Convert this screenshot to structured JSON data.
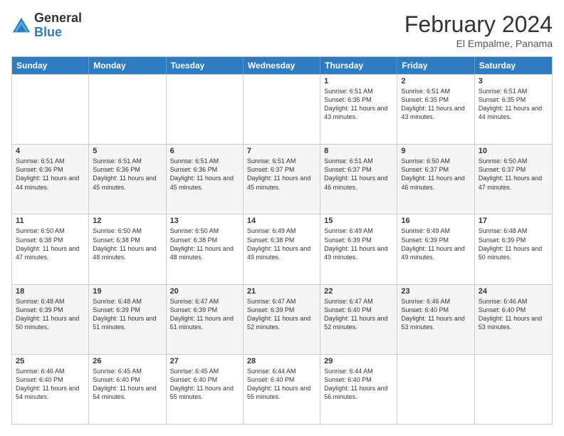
{
  "header": {
    "logo_general": "General",
    "logo_blue": "Blue",
    "month_year": "February 2024",
    "location": "El Empalme, Panama"
  },
  "days_of_week": [
    "Sunday",
    "Monday",
    "Tuesday",
    "Wednesday",
    "Thursday",
    "Friday",
    "Saturday"
  ],
  "weeks": [
    [
      {
        "day": "",
        "sunrise": "",
        "sunset": "",
        "daylight": ""
      },
      {
        "day": "",
        "sunrise": "",
        "sunset": "",
        "daylight": ""
      },
      {
        "day": "",
        "sunrise": "",
        "sunset": "",
        "daylight": ""
      },
      {
        "day": "",
        "sunrise": "",
        "sunset": "",
        "daylight": ""
      },
      {
        "day": "1",
        "sunrise": "6:51 AM",
        "sunset": "6:35 PM",
        "daylight": "11 hours and 43 minutes."
      },
      {
        "day": "2",
        "sunrise": "6:51 AM",
        "sunset": "6:35 PM",
        "daylight": "11 hours and 43 minutes."
      },
      {
        "day": "3",
        "sunrise": "6:51 AM",
        "sunset": "6:35 PM",
        "daylight": "11 hours and 44 minutes."
      }
    ],
    [
      {
        "day": "4",
        "sunrise": "6:51 AM",
        "sunset": "6:36 PM",
        "daylight": "11 hours and 44 minutes."
      },
      {
        "day": "5",
        "sunrise": "6:51 AM",
        "sunset": "6:36 PM",
        "daylight": "11 hours and 45 minutes."
      },
      {
        "day": "6",
        "sunrise": "6:51 AM",
        "sunset": "6:36 PM",
        "daylight": "11 hours and 45 minutes."
      },
      {
        "day": "7",
        "sunrise": "6:51 AM",
        "sunset": "6:37 PM",
        "daylight": "11 hours and 45 minutes."
      },
      {
        "day": "8",
        "sunrise": "6:51 AM",
        "sunset": "6:37 PM",
        "daylight": "11 hours and 46 minutes."
      },
      {
        "day": "9",
        "sunrise": "6:50 AM",
        "sunset": "6:37 PM",
        "daylight": "11 hours and 46 minutes."
      },
      {
        "day": "10",
        "sunrise": "6:50 AM",
        "sunset": "6:37 PM",
        "daylight": "11 hours and 47 minutes."
      }
    ],
    [
      {
        "day": "11",
        "sunrise": "6:50 AM",
        "sunset": "6:38 PM",
        "daylight": "11 hours and 47 minutes."
      },
      {
        "day": "12",
        "sunrise": "6:50 AM",
        "sunset": "6:38 PM",
        "daylight": "11 hours and 48 minutes."
      },
      {
        "day": "13",
        "sunrise": "6:50 AM",
        "sunset": "6:38 PM",
        "daylight": "11 hours and 48 minutes."
      },
      {
        "day": "14",
        "sunrise": "6:49 AM",
        "sunset": "6:38 PM",
        "daylight": "11 hours and 49 minutes."
      },
      {
        "day": "15",
        "sunrise": "6:49 AM",
        "sunset": "6:39 PM",
        "daylight": "11 hours and 49 minutes."
      },
      {
        "day": "16",
        "sunrise": "6:49 AM",
        "sunset": "6:39 PM",
        "daylight": "11 hours and 49 minutes."
      },
      {
        "day": "17",
        "sunrise": "6:48 AM",
        "sunset": "6:39 PM",
        "daylight": "11 hours and 50 minutes."
      }
    ],
    [
      {
        "day": "18",
        "sunrise": "6:48 AM",
        "sunset": "6:39 PM",
        "daylight": "11 hours and 50 minutes."
      },
      {
        "day": "19",
        "sunrise": "6:48 AM",
        "sunset": "6:39 PM",
        "daylight": "11 hours and 51 minutes."
      },
      {
        "day": "20",
        "sunrise": "6:47 AM",
        "sunset": "6:39 PM",
        "daylight": "11 hours and 51 minutes."
      },
      {
        "day": "21",
        "sunrise": "6:47 AM",
        "sunset": "6:39 PM",
        "daylight": "11 hours and 52 minutes."
      },
      {
        "day": "22",
        "sunrise": "6:47 AM",
        "sunset": "6:40 PM",
        "daylight": "11 hours and 52 minutes."
      },
      {
        "day": "23",
        "sunrise": "6:46 AM",
        "sunset": "6:40 PM",
        "daylight": "11 hours and 53 minutes."
      },
      {
        "day": "24",
        "sunrise": "6:46 AM",
        "sunset": "6:40 PM",
        "daylight": "11 hours and 53 minutes."
      }
    ],
    [
      {
        "day": "25",
        "sunrise": "6:46 AM",
        "sunset": "6:40 PM",
        "daylight": "11 hours and 54 minutes."
      },
      {
        "day": "26",
        "sunrise": "6:45 AM",
        "sunset": "6:40 PM",
        "daylight": "11 hours and 54 minutes."
      },
      {
        "day": "27",
        "sunrise": "6:45 AM",
        "sunset": "6:40 PM",
        "daylight": "11 hours and 55 minutes."
      },
      {
        "day": "28",
        "sunrise": "6:44 AM",
        "sunset": "6:40 PM",
        "daylight": "11 hours and 55 minutes."
      },
      {
        "day": "29",
        "sunrise": "6:44 AM",
        "sunset": "6:40 PM",
        "daylight": "11 hours and 56 minutes."
      },
      {
        "day": "",
        "sunrise": "",
        "sunset": "",
        "daylight": ""
      },
      {
        "day": "",
        "sunrise": "",
        "sunset": "",
        "daylight": ""
      }
    ]
  ]
}
